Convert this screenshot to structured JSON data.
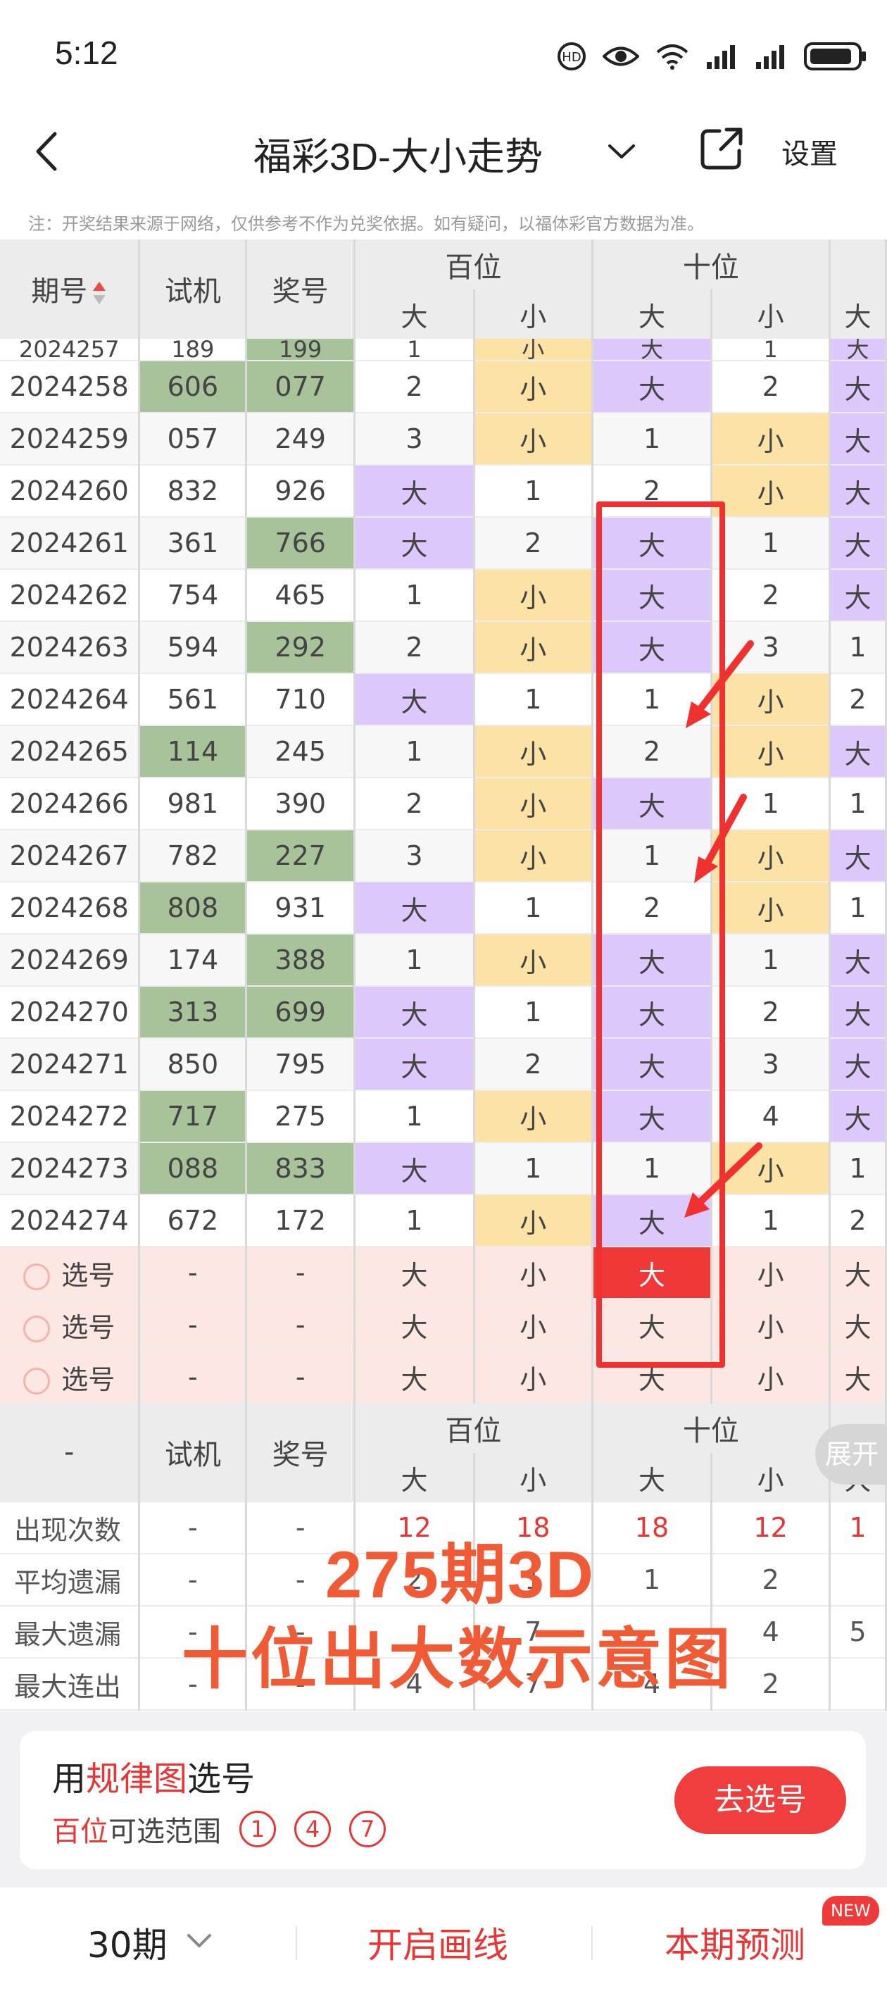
{
  "status": {
    "time": "5:12"
  },
  "header": {
    "title": "福彩3D-大小走势",
    "settings": "设置"
  },
  "note": "注：开奖结果来源于网络，仅供参考不作为兑奖依据。如有疑问，以福体彩官方数据为准。",
  "table": {
    "headers": {
      "issue": "期号",
      "trial": "试机",
      "prize": "奖号",
      "hundreds": "百位",
      "tens": "十位",
      "big": "大",
      "small": "小"
    },
    "partial_row": {
      "issue": "2024257",
      "trial": "189",
      "prize": "199",
      "h": "1",
      "hs": "小",
      "t": "大",
      "ts": "1",
      "c": "大"
    },
    "rows": [
      {
        "issue": "2024258",
        "trial": "606",
        "prize": "077",
        "h_big": "2",
        "h_small": "小",
        "t_big": "大",
        "t_small": "2",
        "c": "大"
      },
      {
        "issue": "2024259",
        "trial": "057",
        "prize": "249",
        "h_big": "3",
        "h_small": "小",
        "t_big": "1",
        "t_small": "小",
        "c": "大"
      },
      {
        "issue": "2024260",
        "trial": "832",
        "prize": "926",
        "h_big": "大",
        "h_small": "1",
        "t_big": "2",
        "t_small": "小",
        "c": "大"
      },
      {
        "issue": "2024261",
        "trial": "361",
        "prize": "766",
        "h_big": "大",
        "h_small": "2",
        "t_big": "大",
        "t_small": "1",
        "c": "大"
      },
      {
        "issue": "2024262",
        "trial": "754",
        "prize": "465",
        "h_big": "1",
        "h_small": "小",
        "t_big": "大",
        "t_small": "2",
        "c": "大"
      },
      {
        "issue": "2024263",
        "trial": "594",
        "prize": "292",
        "h_big": "2",
        "h_small": "小",
        "t_big": "大",
        "t_small": "3",
        "c": "1"
      },
      {
        "issue": "2024264",
        "trial": "561",
        "prize": "710",
        "h_big": "大",
        "h_small": "1",
        "t_big": "1",
        "t_small": "小",
        "c": "2"
      },
      {
        "issue": "2024265",
        "trial": "114",
        "prize": "245",
        "h_big": "1",
        "h_small": "小",
        "t_big": "2",
        "t_small": "小",
        "c": "大"
      },
      {
        "issue": "2024266",
        "trial": "981",
        "prize": "390",
        "h_big": "2",
        "h_small": "小",
        "t_big": "大",
        "t_small": "1",
        "c": "1"
      },
      {
        "issue": "2024267",
        "trial": "782",
        "prize": "227",
        "h_big": "3",
        "h_small": "小",
        "t_big": "1",
        "t_small": "小",
        "c": "大"
      },
      {
        "issue": "2024268",
        "trial": "808",
        "prize": "931",
        "h_big": "大",
        "h_small": "1",
        "t_big": "2",
        "t_small": "小",
        "c": "1"
      },
      {
        "issue": "2024269",
        "trial": "174",
        "prize": "388",
        "h_big": "1",
        "h_small": "小",
        "t_big": "大",
        "t_small": "1",
        "c": "大"
      },
      {
        "issue": "2024270",
        "trial": "313",
        "prize": "699",
        "h_big": "大",
        "h_small": "1",
        "t_big": "大",
        "t_small": "2",
        "c": "大"
      },
      {
        "issue": "2024271",
        "trial": "850",
        "prize": "795",
        "h_big": "大",
        "h_small": "2",
        "t_big": "大",
        "t_small": "3",
        "c": "大"
      },
      {
        "issue": "2024272",
        "trial": "717",
        "prize": "275",
        "h_big": "1",
        "h_small": "小",
        "t_big": "大",
        "t_small": "4",
        "c": "大"
      },
      {
        "issue": "2024273",
        "trial": "088",
        "prize": "833",
        "h_big": "大",
        "h_small": "1",
        "t_big": "1",
        "t_small": "小",
        "c": "1"
      },
      {
        "issue": "2024274",
        "trial": "672",
        "prize": "172",
        "h_big": "1",
        "h_small": "小",
        "t_big": "大",
        "t_small": "1",
        "c": "2"
      }
    ],
    "select_rows": [
      {
        "label": "选号",
        "trial": "-",
        "prize": "-",
        "h_big": "大",
        "h_small": "小",
        "t_big": "大",
        "t_small": "小",
        "c": "大",
        "selected": "tens-big"
      },
      {
        "label": "选号",
        "trial": "-",
        "prize": "-",
        "h_big": "大",
        "h_small": "小",
        "t_big": "大",
        "t_small": "小",
        "c": "大"
      },
      {
        "label": "选号",
        "trial": "-",
        "prize": "-",
        "h_big": "大",
        "h_small": "小",
        "t_big": "大",
        "t_small": "小",
        "c": "大"
      }
    ],
    "stats_header": {
      "dash": "-",
      "trial": "试机",
      "prize": "奖号",
      "hundreds": "百位",
      "tens": "十位",
      "big": "大",
      "small": "小",
      "expand": "展开"
    },
    "stats": [
      {
        "label": "出现次数",
        "trial": "-",
        "prize": "-",
        "h_big": "12",
        "h_small": "18",
        "t_big": "18",
        "t_small": "12",
        "c": "1"
      },
      {
        "label": "平均遗漏",
        "trial": "-",
        "prize": "-",
        "h_big": "2",
        "h_small": "1",
        "t_big": "1",
        "t_small": "2",
        "c": ""
      },
      {
        "label": "最大遗漏",
        "trial": "-",
        "prize": "-",
        "h_big": "",
        "h_small": "7",
        "t_big": "",
        "t_small": "4",
        "c": "5"
      },
      {
        "label": "最大连出",
        "trial": "-",
        "prize": "-",
        "h_big": "4",
        "h_small": "7",
        "t_big": "4",
        "t_small": "2",
        "c": ""
      }
    ]
  },
  "overlay": {
    "line1": "275期3D",
    "line2": "十位出大数示意图"
  },
  "card": {
    "title_prefix": "用",
    "title_red": "规律图",
    "title_suffix": "选号",
    "sub_red": "百位",
    "sub_text": "可选范围",
    "choices": [
      "1",
      "4",
      "7"
    ],
    "button": "去选号"
  },
  "bottom": {
    "period": "30期",
    "draw_line": "开启画线",
    "predict": "本期预测",
    "new_badge": "NEW"
  }
}
